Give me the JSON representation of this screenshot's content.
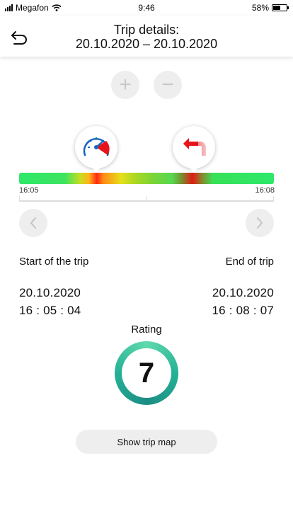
{
  "status_bar": {
    "carrier": "Megafon",
    "time": "9:46",
    "battery_percent": "58%",
    "battery_level": 0.58
  },
  "header": {
    "title_line1": "Trip details:",
    "title_line2": "20.10.2020 – 20.10.2020",
    "back_icon": "back-arrow-icon"
  },
  "zoom": {
    "zoom_in_label": "+",
    "zoom_out_label": "−"
  },
  "timeline": {
    "start_time": "16:05",
    "end_time": "16:08",
    "markers": [
      {
        "icon": "speedometer-icon",
        "event": "speeding"
      },
      {
        "icon": "sharp-turn-icon",
        "event": "sharp turn"
      }
    ]
  },
  "navigation": {
    "prev_icon": "chevron-left-icon",
    "next_icon": "chevron-right-icon"
  },
  "trip": {
    "start_label": "Start of the trip",
    "end_label": "End of trip",
    "start_date": "20.10.2020",
    "start_time": "16 : 05 : 04",
    "end_date": "20.10.2020",
    "end_time": "16 : 08 : 07"
  },
  "rating": {
    "label": "Rating",
    "value": "7"
  },
  "actions": {
    "show_map_label": "Show trip map"
  },
  "colors": {
    "accent_ring": "#25b196",
    "alert_red": "#e8141b",
    "gauge_blue": "#1565c0",
    "button_gray": "#eeeeee"
  }
}
